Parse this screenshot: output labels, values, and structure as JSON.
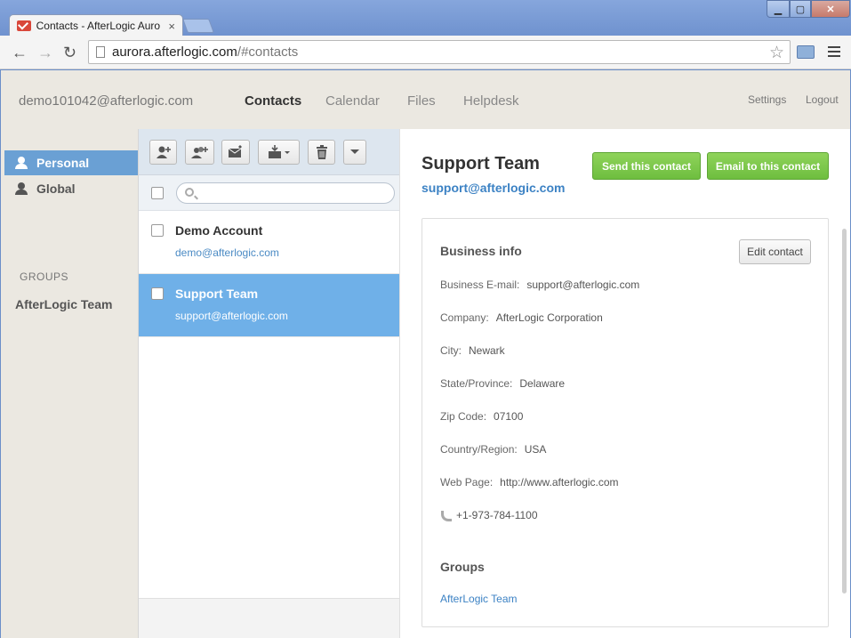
{
  "browser": {
    "tab_title": "Contacts - AfterLogic Auro",
    "tab_close": "×",
    "url_host": "aurora.afterlogic.com",
    "url_path": "/#contacts",
    "win_min": "▁",
    "win_max": "▢",
    "win_close": "✕",
    "back": "←",
    "forward": "→",
    "reload": "↻",
    "star": "☆"
  },
  "header": {
    "account": "demo101042@afterlogic.com",
    "nav": [
      "Contacts",
      "Calendar",
      "Files",
      "Helpdesk"
    ],
    "active_nav": "Contacts",
    "settings": "Settings",
    "logout": "Logout"
  },
  "sidebar": {
    "items": [
      {
        "label": "Personal",
        "icon": "person-icon",
        "active": true
      },
      {
        "label": "Global",
        "icon": "globe-person-icon",
        "active": false
      }
    ],
    "groups_label": "GROUPS",
    "groups": [
      "AfterLogic Team"
    ]
  },
  "list": {
    "toolbar_icons": [
      "add-contact-icon",
      "add-group-icon",
      "new-message-icon",
      "import-icon",
      "delete-icon",
      "more-icon"
    ],
    "search_placeholder": "",
    "contacts": [
      {
        "name": "Demo Account",
        "email": "demo@afterlogic.com",
        "selected": false
      },
      {
        "name": "Support Team",
        "email": "support@afterlogic.com",
        "selected": true
      }
    ]
  },
  "detail": {
    "name": "Support Team",
    "email": "support@afterlogic.com",
    "send_contact": "Send this contact",
    "email_contact": "Email to this contact",
    "business_title": "Business info",
    "edit_contact": "Edit contact",
    "fields": [
      {
        "label": "Business E-mail:",
        "value": "support@afterlogic.com"
      },
      {
        "label": "Company:",
        "value": "AfterLogic Corporation"
      },
      {
        "label": "City:",
        "value": "Newark"
      },
      {
        "label": "State/Province:",
        "value": "Delaware"
      },
      {
        "label": "Zip Code:",
        "value": "07100"
      },
      {
        "label": "Country/Region:",
        "value": "USA"
      },
      {
        "label": "Web Page:",
        "value": "http://www.afterlogic.com"
      }
    ],
    "phone": "+1-973-784-1100",
    "groups_title": "Groups",
    "groups": [
      "AfterLogic Team"
    ]
  },
  "colors": {
    "accent_blue": "#6aa0d4",
    "green_button": "#7cc84b",
    "link_blue": "#3c82c4"
  }
}
